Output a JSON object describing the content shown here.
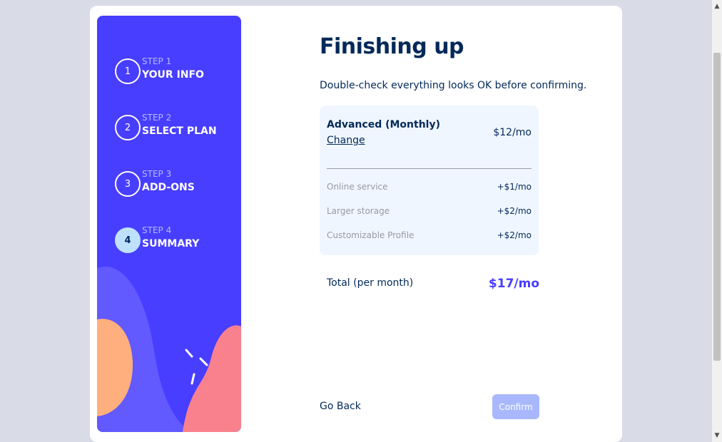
{
  "steps": [
    {
      "number": "1",
      "label": "STEP 1",
      "title": "YOUR INFO",
      "active": false
    },
    {
      "number": "2",
      "label": "STEP 2",
      "title": "SELECT PLAN",
      "active": false
    },
    {
      "number": "3",
      "label": "STEP 3",
      "title": "ADD-ONS",
      "active": false
    },
    {
      "number": "4",
      "label": "STEP 4",
      "title": "SUMMARY",
      "active": true
    }
  ],
  "main": {
    "title": "Finishing up",
    "subtitle": "Double-check everything looks OK before confirming."
  },
  "summary": {
    "plan_name": "Advanced (Monthly)",
    "change_label": "Change",
    "plan_price": "$12/mo",
    "addons": [
      {
        "name": "Online service",
        "price": "+$1/mo"
      },
      {
        "name": "Larger storage",
        "price": "+$2/mo"
      },
      {
        "name": "Customizable Profile",
        "price": "+$2/mo"
      }
    ],
    "total_label": "Total (per month)",
    "total_price": "$17/mo"
  },
  "nav": {
    "back_label": "Go Back",
    "confirm_label": "Confirm"
  },
  "colors": {
    "sidebar": "#483eff",
    "marine_blue": "#022959",
    "accent": "#483eff",
    "confirm_button": "#a9b8fc"
  }
}
